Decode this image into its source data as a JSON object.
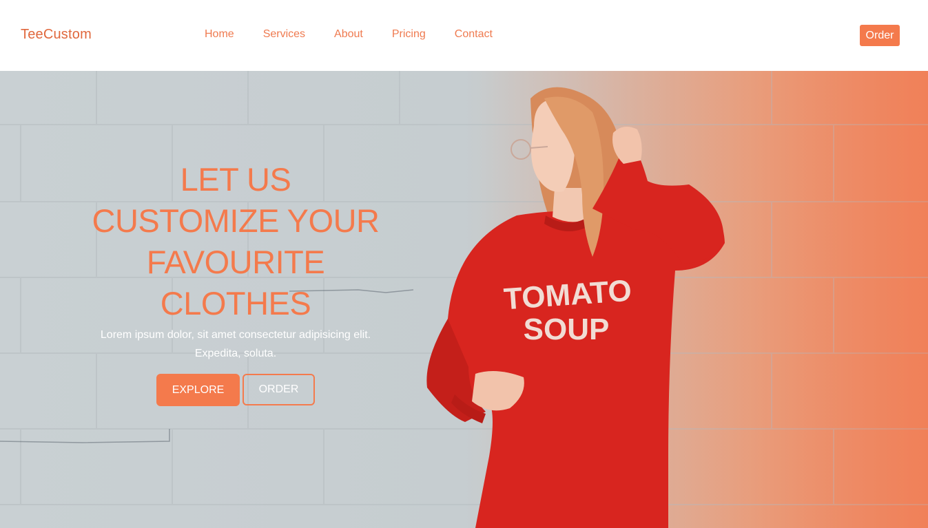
{
  "navbar": {
    "brand": "TeeCustom",
    "links": [
      {
        "label": "Home"
      },
      {
        "label": "Services"
      },
      {
        "label": "About"
      },
      {
        "label": "Pricing"
      },
      {
        "label": "Contact"
      }
    ],
    "order_label": "Order"
  },
  "hero": {
    "title_lines": [
      "LET US",
      "CUSTOMIZE YOUR",
      "FAVOURITE",
      "CLOTHES"
    ],
    "subtitle": "Lorem ipsum dolor, sit amet consectetur adipisicing elit. Expedita, soluta.",
    "explore_label": "EXPLORE",
    "order_label": "ORDER",
    "shirt_text_line1": "TOMATO",
    "shirt_text_line2": "SOUP"
  },
  "colors": {
    "accent": "#f47a4c",
    "brand": "#e0673c",
    "sweater": "#d8251f"
  }
}
